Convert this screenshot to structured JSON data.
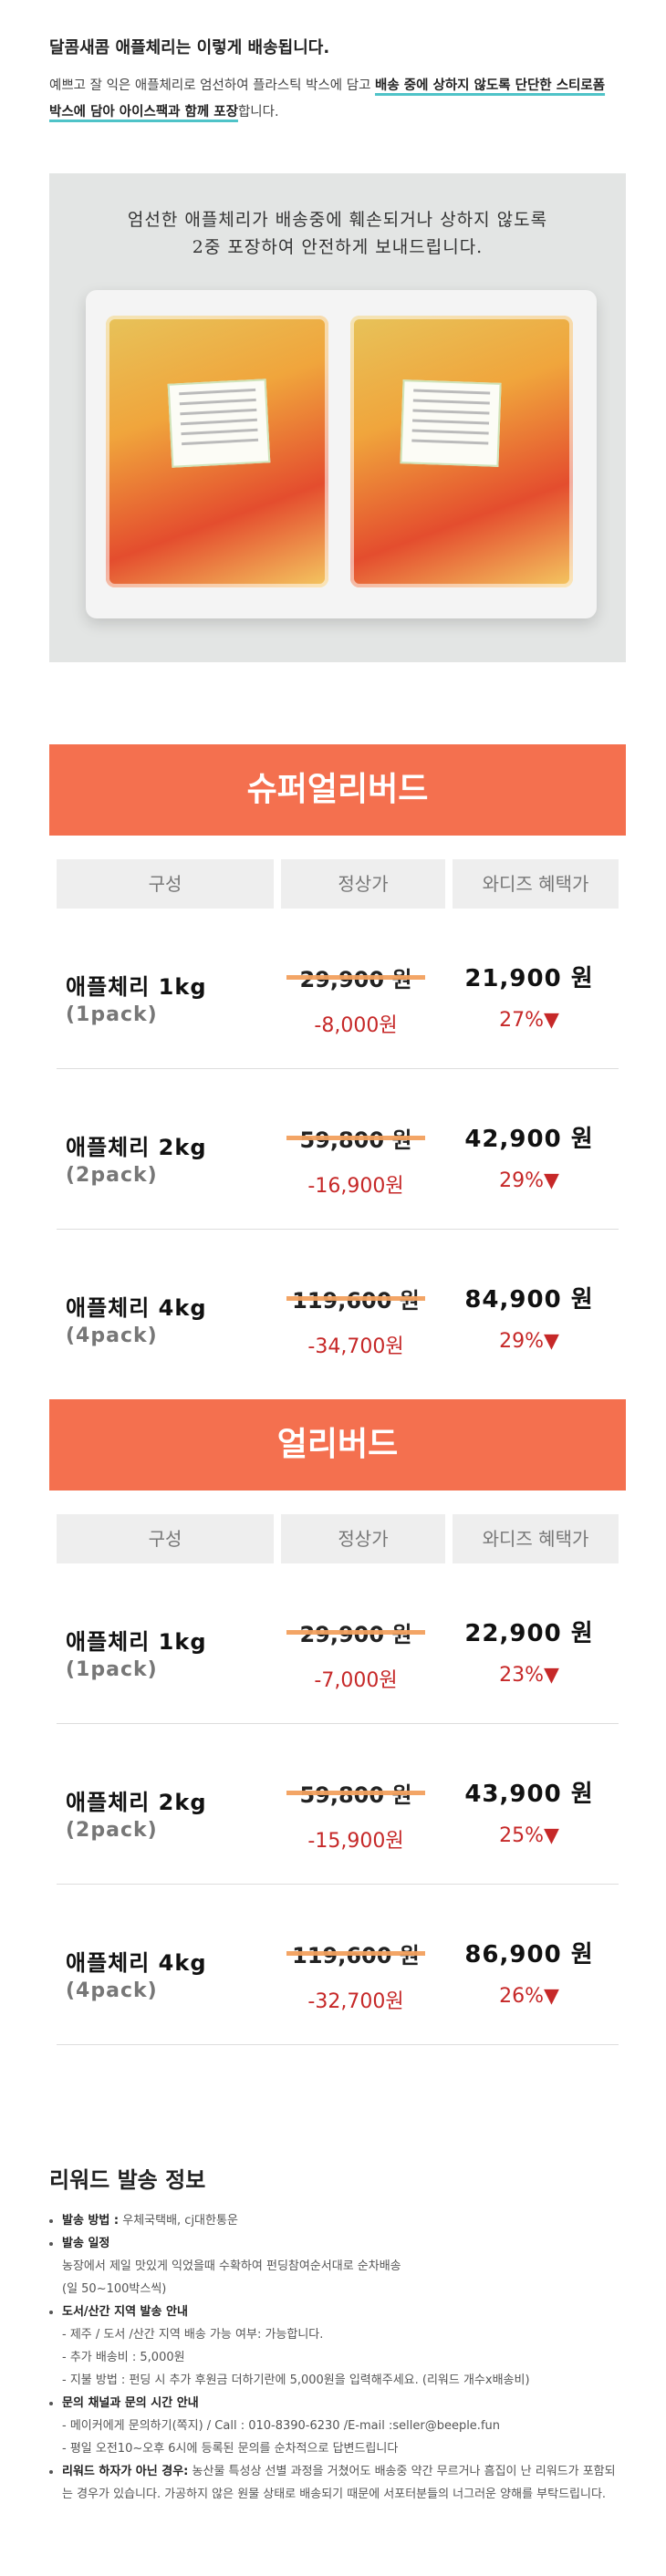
{
  "header": {
    "title": "달콤새콤 애플체리는 이렇게 배송됩니다.",
    "intro_plain_1": "예쁘고 잘 익은 애플체리로 엄선하여 플라스틱 박스에 담고 ",
    "intro_bold_1": "배송 중에 상하지 않도록 단단한 스티로폼 박스에 담아 아이스팩과 함께 포장",
    "intro_plain_2": "합니다."
  },
  "photo": {
    "caption_line1": "엄선한 애플체리가 배송중에 훼손되거나 상하지 않도록",
    "caption_line2": "2중 포장하여 안전하게 보내드립니다."
  },
  "table_headers": {
    "composition": "구성",
    "regular_price": "정상가",
    "wadiz_price": "와디즈 혜택가"
  },
  "sections": [
    {
      "title": "슈퍼얼리버드",
      "rows": [
        {
          "name": "애플체리 1kg",
          "pack": "(1pack)",
          "original": "29,900 원",
          "discount": "-8,000원",
          "price": "21,900 원",
          "percent": "27%▼"
        },
        {
          "name": "애플체리 2kg",
          "pack": "(2pack)",
          "original": "59,800 원",
          "discount": "-16,900원",
          "price": "42,900 원",
          "percent": "29%▼"
        },
        {
          "name": "애플체리 4kg",
          "pack": "(4pack)",
          "original": "119,600 원",
          "discount": "-34,700원",
          "price": "84,900 원",
          "percent": "29%▼"
        }
      ]
    },
    {
      "title": "얼리버드",
      "rows": [
        {
          "name": "애플체리 1kg",
          "pack": "(1pack)",
          "original": "29,900 원",
          "discount": "-7,000원",
          "price": "22,900 원",
          "percent": "23%▼"
        },
        {
          "name": "애플체리 2kg",
          "pack": "(2pack)",
          "original": "59,800 원",
          "discount": "-15,900원",
          "price": "43,900 원",
          "percent": "25%▼"
        },
        {
          "name": "애플체리 4kg",
          "pack": "(4pack)",
          "original": "119,600 원",
          "discount": "-32,700원",
          "price": "86,900 원",
          "percent": "26%▼"
        }
      ]
    }
  ],
  "info": {
    "title": "리워드 발송 정보",
    "method_label": "발송 방법 :",
    "method_text": "우체국택배, cj대한통운",
    "schedule_label": "발송 일정",
    "schedule_1": "농장에서 제일 맛있게 익었을때 수확하여 펀딩참여순서대로 순차배송",
    "schedule_2": "(일 50~100박스씩)",
    "island_label": "도서/산간 지역 발송 안내",
    "island_1": "- 제주 / 도서 /산간 지역 배송 가능 여부: 가능합니다.",
    "island_2": "- 추가 배송비 : 5,000원",
    "island_3": "- 지불 방법 : 펀딩 시 추가 후원금 더하기란에 5,000원을 입력해주세요. (리워드 개수x배송비)",
    "contact_label": "문의 채널과 문의 시간 안내",
    "contact_1": "- 메이커에게 문의하기(쪽지) / Call : 010-8390-6230 /E-mail :seller@beeple.fun",
    "contact_2": "- 평일 오전10~오후 6시에 등록된 문의를 순차적으로 답변드립니다",
    "defect_label": "리워드 하자가 아닌 경우:",
    "defect_text": "농산물 특성상 선별 과정을 거쳤어도 배송중 약간 무르거나 흠집이 난 리워드가 포함되는 경우가 있습니다. 가공하지 않은 원물 상태로 배송되기 때문에 서포터분들의 너그러운 양해를 부탁드립니다."
  }
}
